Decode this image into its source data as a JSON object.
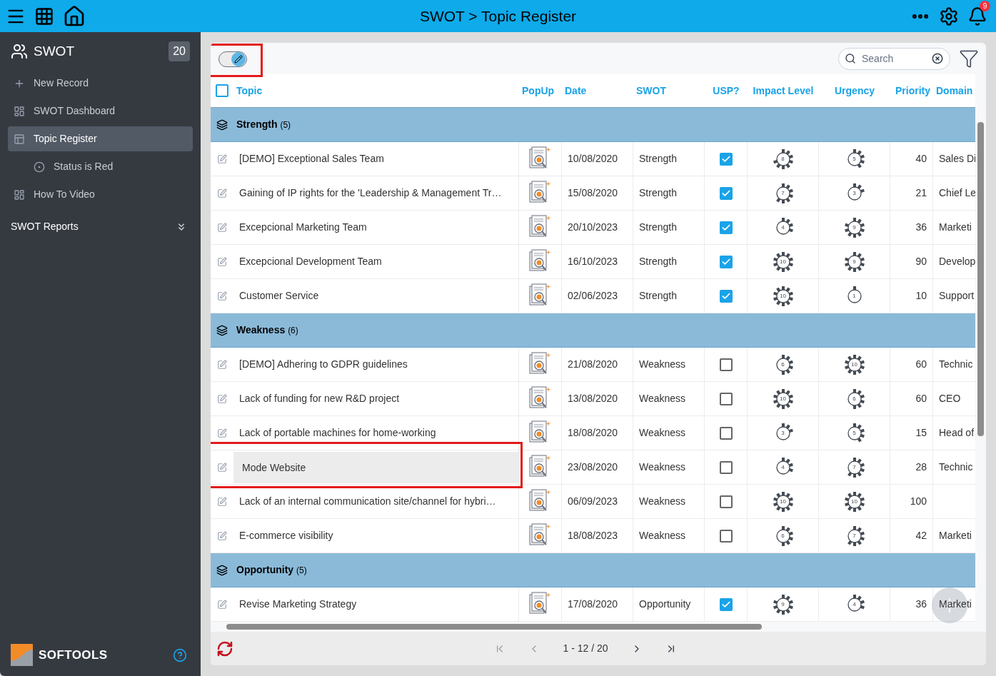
{
  "topbar": {
    "title": "SWOT > Topic Register",
    "notification_count": "9"
  },
  "sidebar": {
    "app_name": "SWOT",
    "record_count": "20",
    "items": [
      {
        "label": "New Record",
        "kind": "add",
        "selected": false
      },
      {
        "label": "SWOT Dashboard",
        "kind": "dashboard",
        "selected": false
      },
      {
        "label": "Topic Register",
        "kind": "register",
        "selected": true,
        "children": [
          {
            "label": "Status is Red",
            "kind": "filter",
            "selected": false
          }
        ]
      },
      {
        "label": "How To Video",
        "kind": "dashboard",
        "selected": false
      }
    ],
    "section": {
      "label": "SWOT Reports",
      "expanded": false
    },
    "brand": "SOFTOOLS"
  },
  "toolbar": {
    "edit_mode": true,
    "search": {
      "placeholder": "Search"
    }
  },
  "table": {
    "select_all": false,
    "columns": [
      "Topic",
      "PopUp",
      "Date",
      "SWOT",
      "USP?",
      "Impact Level",
      "Urgency",
      "Priority",
      "Domain"
    ],
    "groups": [
      {
        "label": "Strength",
        "count": "(5)",
        "rows": [
          {
            "topic": "[DEMO] Exceptional Sales Team",
            "editing": false,
            "date": "10/08/2020",
            "swot": "Strength",
            "usp": true,
            "impact": {
              "value": "8"
            },
            "urgency": {
              "value": "5"
            },
            "priority": "40",
            "domain": "Sales Di"
          },
          {
            "topic": "Gaining of IP rights for the 'Leadership & Management Tr…",
            "editing": false,
            "date": "15/08/2020",
            "swot": "Strength",
            "usp": true,
            "impact": {
              "value": "7"
            },
            "urgency": {
              "value": "3"
            },
            "priority": "21",
            "domain": "Chief Le"
          },
          {
            "topic": "Excepcional Marketing Team",
            "editing": false,
            "date": "20/10/2023",
            "swot": "Strength",
            "usp": true,
            "impact": {
              "value": "4"
            },
            "urgency": {
              "value": "9"
            },
            "priority": "36",
            "domain": "Marketi"
          },
          {
            "topic": "Excepcional Development Team",
            "editing": false,
            "date": "16/10/2023",
            "swot": "Strength",
            "usp": true,
            "impact": {
              "value": "10"
            },
            "urgency": {
              "value": "9"
            },
            "priority": "90",
            "domain": "Develop"
          },
          {
            "topic": "Customer Service",
            "editing": false,
            "date": "02/06/2023",
            "swot": "Strength",
            "usp": true,
            "impact": {
              "value": "10"
            },
            "urgency": {
              "value": "1"
            },
            "priority": "10",
            "domain": "Support"
          }
        ]
      },
      {
        "label": "Weakness",
        "count": "(6)",
        "rows": [
          {
            "topic": "[DEMO] Adhering to GDPR guidelines",
            "editing": false,
            "date": "21/08/2020",
            "swot": "Weakness",
            "usp": false,
            "impact": {
              "value": "6"
            },
            "urgency": {
              "value": "10"
            },
            "priority": "60",
            "domain": "Technic"
          },
          {
            "topic": "Lack of funding for new R&D project",
            "editing": false,
            "date": "13/08/2020",
            "swot": "Weakness",
            "usp": false,
            "impact": {
              "value": "10"
            },
            "urgency": {
              "value": "6"
            },
            "priority": "60",
            "domain": "CEO"
          },
          {
            "topic": "Lack of portable machines for home-working",
            "editing": false,
            "date": "18/08/2020",
            "swot": "Weakness",
            "usp": false,
            "impact": {
              "value": "3"
            },
            "urgency": {
              "value": "5"
            },
            "priority": "15",
            "domain": "Head of"
          },
          {
            "topic": "Mode Website",
            "editing": true,
            "date": "23/08/2020",
            "swot": "Weakness",
            "usp": false,
            "impact": {
              "value": "4"
            },
            "urgency": {
              "value": "7"
            },
            "priority": "28",
            "domain": "Technic"
          },
          {
            "topic": "Lack of an internal communication site/channel for hybri…",
            "editing": false,
            "date": "06/09/2023",
            "swot": "Weakness",
            "usp": false,
            "impact": {
              "value": "10"
            },
            "urgency": {
              "value": "10"
            },
            "priority": "100"
          },
          {
            "topic": "E-commerce visibility",
            "editing": false,
            "date": "18/08/2023",
            "swot": "Weakness",
            "usp": false,
            "impact": {
              "value": "6"
            },
            "urgency": {
              "value": "7"
            },
            "priority": "42",
            "domain": "Marketi"
          }
        ]
      },
      {
        "label": "Opportunity",
        "count": "(5)",
        "rows": [
          {
            "topic": "Revise Marketing Strategy",
            "editing": false,
            "date": "17/08/2020",
            "swot": "Opportunity",
            "usp": true,
            "impact": {
              "value": "9"
            },
            "urgency": {
              "value": "4"
            },
            "priority": "36",
            "domain": "Marketi"
          }
        ]
      }
    ]
  },
  "pagination": {
    "range": "1 - 12 / 20"
  }
}
